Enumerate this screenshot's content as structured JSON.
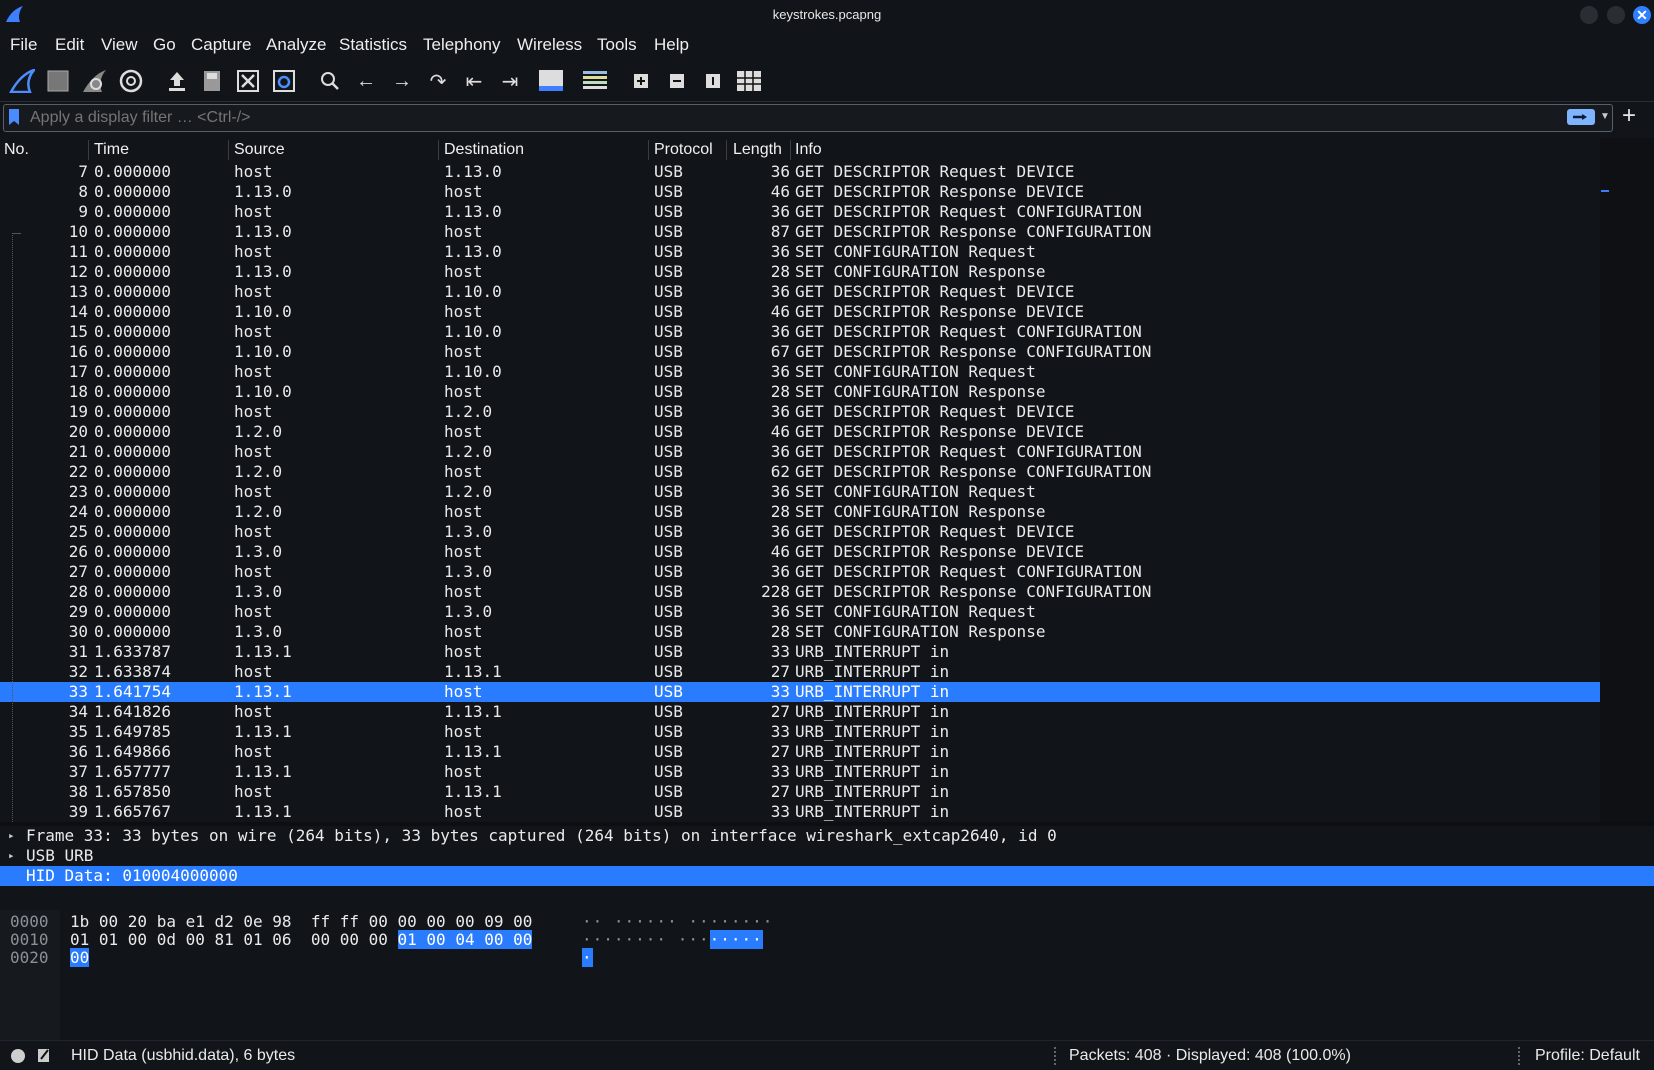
{
  "window": {
    "title": "keystrokes.pcapng"
  },
  "menu": [
    "File",
    "Edit",
    "View",
    "Go",
    "Capture",
    "Analyze",
    "Statistics",
    "Telephony",
    "Wireless",
    "Tools",
    "Help"
  ],
  "toolbar": [
    "shark-fin-start-icon",
    "stop-square-icon",
    "restart-fin-icon",
    "capture-options-gear-icon",
    "open-file-icon",
    "save-file-icon",
    "close-file-icon",
    "reload-file-icon",
    "find-packet-icon",
    "go-back-icon",
    "go-forward-icon",
    "go-to-packet-icon",
    "first-packet-icon",
    "last-packet-icon",
    "auto-scroll-icon",
    "colorize-icon",
    "zoom-in-icon",
    "zoom-out-icon",
    "normal-size-icon",
    "resize-columns-icon"
  ],
  "filter": {
    "placeholder": "Apply a display filter … <Ctrl-/>",
    "value": ""
  },
  "columns": {
    "no": "No.",
    "time": "Time",
    "source": "Source",
    "destination": "Destination",
    "protocol": "Protocol",
    "length": "Length",
    "info": "Info"
  },
  "packets": [
    {
      "no": "7",
      "time": "0.000000",
      "src": "host",
      "dst": "1.13.0",
      "proto": "USB",
      "len": "36",
      "info": "GET DESCRIPTOR Request DEVICE"
    },
    {
      "no": "8",
      "time": "0.000000",
      "src": "1.13.0",
      "dst": "host",
      "proto": "USB",
      "len": "46",
      "info": "GET DESCRIPTOR Response DEVICE"
    },
    {
      "no": "9",
      "time": "0.000000",
      "src": "host",
      "dst": "1.13.0",
      "proto": "USB",
      "len": "36",
      "info": "GET DESCRIPTOR Request CONFIGURATION"
    },
    {
      "no": "10",
      "time": "0.000000",
      "src": "1.13.0",
      "dst": "host",
      "proto": "USB",
      "len": "87",
      "info": "GET DESCRIPTOR Response CONFIGURATION"
    },
    {
      "no": "11",
      "time": "0.000000",
      "src": "host",
      "dst": "1.13.0",
      "proto": "USB",
      "len": "36",
      "info": "SET CONFIGURATION Request"
    },
    {
      "no": "12",
      "time": "0.000000",
      "src": "1.13.0",
      "dst": "host",
      "proto": "USB",
      "len": "28",
      "info": "SET CONFIGURATION Response"
    },
    {
      "no": "13",
      "time": "0.000000",
      "src": "host",
      "dst": "1.10.0",
      "proto": "USB",
      "len": "36",
      "info": "GET DESCRIPTOR Request DEVICE"
    },
    {
      "no": "14",
      "time": "0.000000",
      "src": "1.10.0",
      "dst": "host",
      "proto": "USB",
      "len": "46",
      "info": "GET DESCRIPTOR Response DEVICE"
    },
    {
      "no": "15",
      "time": "0.000000",
      "src": "host",
      "dst": "1.10.0",
      "proto": "USB",
      "len": "36",
      "info": "GET DESCRIPTOR Request CONFIGURATION"
    },
    {
      "no": "16",
      "time": "0.000000",
      "src": "1.10.0",
      "dst": "host",
      "proto": "USB",
      "len": "67",
      "info": "GET DESCRIPTOR Response CONFIGURATION"
    },
    {
      "no": "17",
      "time": "0.000000",
      "src": "host",
      "dst": "1.10.0",
      "proto": "USB",
      "len": "36",
      "info": "SET CONFIGURATION Request"
    },
    {
      "no": "18",
      "time": "0.000000",
      "src": "1.10.0",
      "dst": "host",
      "proto": "USB",
      "len": "28",
      "info": "SET CONFIGURATION Response"
    },
    {
      "no": "19",
      "time": "0.000000",
      "src": "host",
      "dst": "1.2.0",
      "proto": "USB",
      "len": "36",
      "info": "GET DESCRIPTOR Request DEVICE"
    },
    {
      "no": "20",
      "time": "0.000000",
      "src": "1.2.0",
      "dst": "host",
      "proto": "USB",
      "len": "46",
      "info": "GET DESCRIPTOR Response DEVICE"
    },
    {
      "no": "21",
      "time": "0.000000",
      "src": "host",
      "dst": "1.2.0",
      "proto": "USB",
      "len": "36",
      "info": "GET DESCRIPTOR Request CONFIGURATION"
    },
    {
      "no": "22",
      "time": "0.000000",
      "src": "1.2.0",
      "dst": "host",
      "proto": "USB",
      "len": "62",
      "info": "GET DESCRIPTOR Response CONFIGURATION"
    },
    {
      "no": "23",
      "time": "0.000000",
      "src": "host",
      "dst": "1.2.0",
      "proto": "USB",
      "len": "36",
      "info": "SET CONFIGURATION Request"
    },
    {
      "no": "24",
      "time": "0.000000",
      "src": "1.2.0",
      "dst": "host",
      "proto": "USB",
      "len": "28",
      "info": "SET CONFIGURATION Response"
    },
    {
      "no": "25",
      "time": "0.000000",
      "src": "host",
      "dst": "1.3.0",
      "proto": "USB",
      "len": "36",
      "info": "GET DESCRIPTOR Request DEVICE"
    },
    {
      "no": "26",
      "time": "0.000000",
      "src": "1.3.0",
      "dst": "host",
      "proto": "USB",
      "len": "46",
      "info": "GET DESCRIPTOR Response DEVICE"
    },
    {
      "no": "27",
      "time": "0.000000",
      "src": "host",
      "dst": "1.3.0",
      "proto": "USB",
      "len": "36",
      "info": "GET DESCRIPTOR Request CONFIGURATION"
    },
    {
      "no": "28",
      "time": "0.000000",
      "src": "1.3.0",
      "dst": "host",
      "proto": "USB",
      "len": "228",
      "info": "GET DESCRIPTOR Response CONFIGURATION"
    },
    {
      "no": "29",
      "time": "0.000000",
      "src": "host",
      "dst": "1.3.0",
      "proto": "USB",
      "len": "36",
      "info": "SET CONFIGURATION Request"
    },
    {
      "no": "30",
      "time": "0.000000",
      "src": "1.3.0",
      "dst": "host",
      "proto": "USB",
      "len": "28",
      "info": "SET CONFIGURATION Response"
    },
    {
      "no": "31",
      "time": "1.633787",
      "src": "1.13.1",
      "dst": "host",
      "proto": "USB",
      "len": "33",
      "info": "URB_INTERRUPT in"
    },
    {
      "no": "32",
      "time": "1.633874",
      "src": "host",
      "dst": "1.13.1",
      "proto": "USB",
      "len": "27",
      "info": "URB_INTERRUPT in"
    },
    {
      "no": "33",
      "time": "1.641754",
      "src": "1.13.1",
      "dst": "host",
      "proto": "USB",
      "len": "33",
      "info": "URB_INTERRUPT in",
      "selected": true
    },
    {
      "no": "34",
      "time": "1.641826",
      "src": "host",
      "dst": "1.13.1",
      "proto": "USB",
      "len": "27",
      "info": "URB_INTERRUPT in"
    },
    {
      "no": "35",
      "time": "1.649785",
      "src": "1.13.1",
      "dst": "host",
      "proto": "USB",
      "len": "33",
      "info": "URB_INTERRUPT in"
    },
    {
      "no": "36",
      "time": "1.649866",
      "src": "host",
      "dst": "1.13.1",
      "proto": "USB",
      "len": "27",
      "info": "URB_INTERRUPT in"
    },
    {
      "no": "37",
      "time": "1.657777",
      "src": "1.13.1",
      "dst": "host",
      "proto": "USB",
      "len": "33",
      "info": "URB_INTERRUPT in"
    },
    {
      "no": "38",
      "time": "1.657850",
      "src": "host",
      "dst": "1.13.1",
      "proto": "USB",
      "len": "27",
      "info": "URB_INTERRUPT in"
    },
    {
      "no": "39",
      "time": "1.665767",
      "src": "1.13.1",
      "dst": "host",
      "proto": "USB",
      "len": "33",
      "info": "URB_INTERRUPT in"
    }
  ],
  "details": [
    {
      "text": "Frame 33: 33 bytes on wire (264 bits), 33 bytes captured (264 bits) on interface wireshark_extcap2640, id 0",
      "expandable": true
    },
    {
      "text": "USB URB",
      "expandable": true
    },
    {
      "text": "HID Data: 010004000000",
      "expandable": false,
      "selected": true
    }
  ],
  "hexdump": [
    {
      "offset": "0000",
      "pre": "1b 00 20 ba e1 d2 0e 98  ff ff 00 00 00 00 09 00",
      "hl": "",
      "ascii_pre": "·· ······ ········",
      "ascii_hl": ""
    },
    {
      "offset": "0010",
      "pre": "01 01 00 0d 00 81 01 06  00 00 00 ",
      "hl": "01 00 04 00 00",
      "ascii_pre": "········ ···",
      "ascii_hl": "·····"
    },
    {
      "offset": "0020",
      "pre": "",
      "hl": "00",
      "ascii_pre": "",
      "ascii_hl": "·"
    }
  ],
  "status": {
    "field": "HID Data (usbhid.data), 6 bytes",
    "packets": "Packets: 408 · Displayed: 408 (100.0%)",
    "profile": "Profile: Default"
  },
  "colors": {
    "accent": "#2a7cff",
    "background": "#111418"
  }
}
